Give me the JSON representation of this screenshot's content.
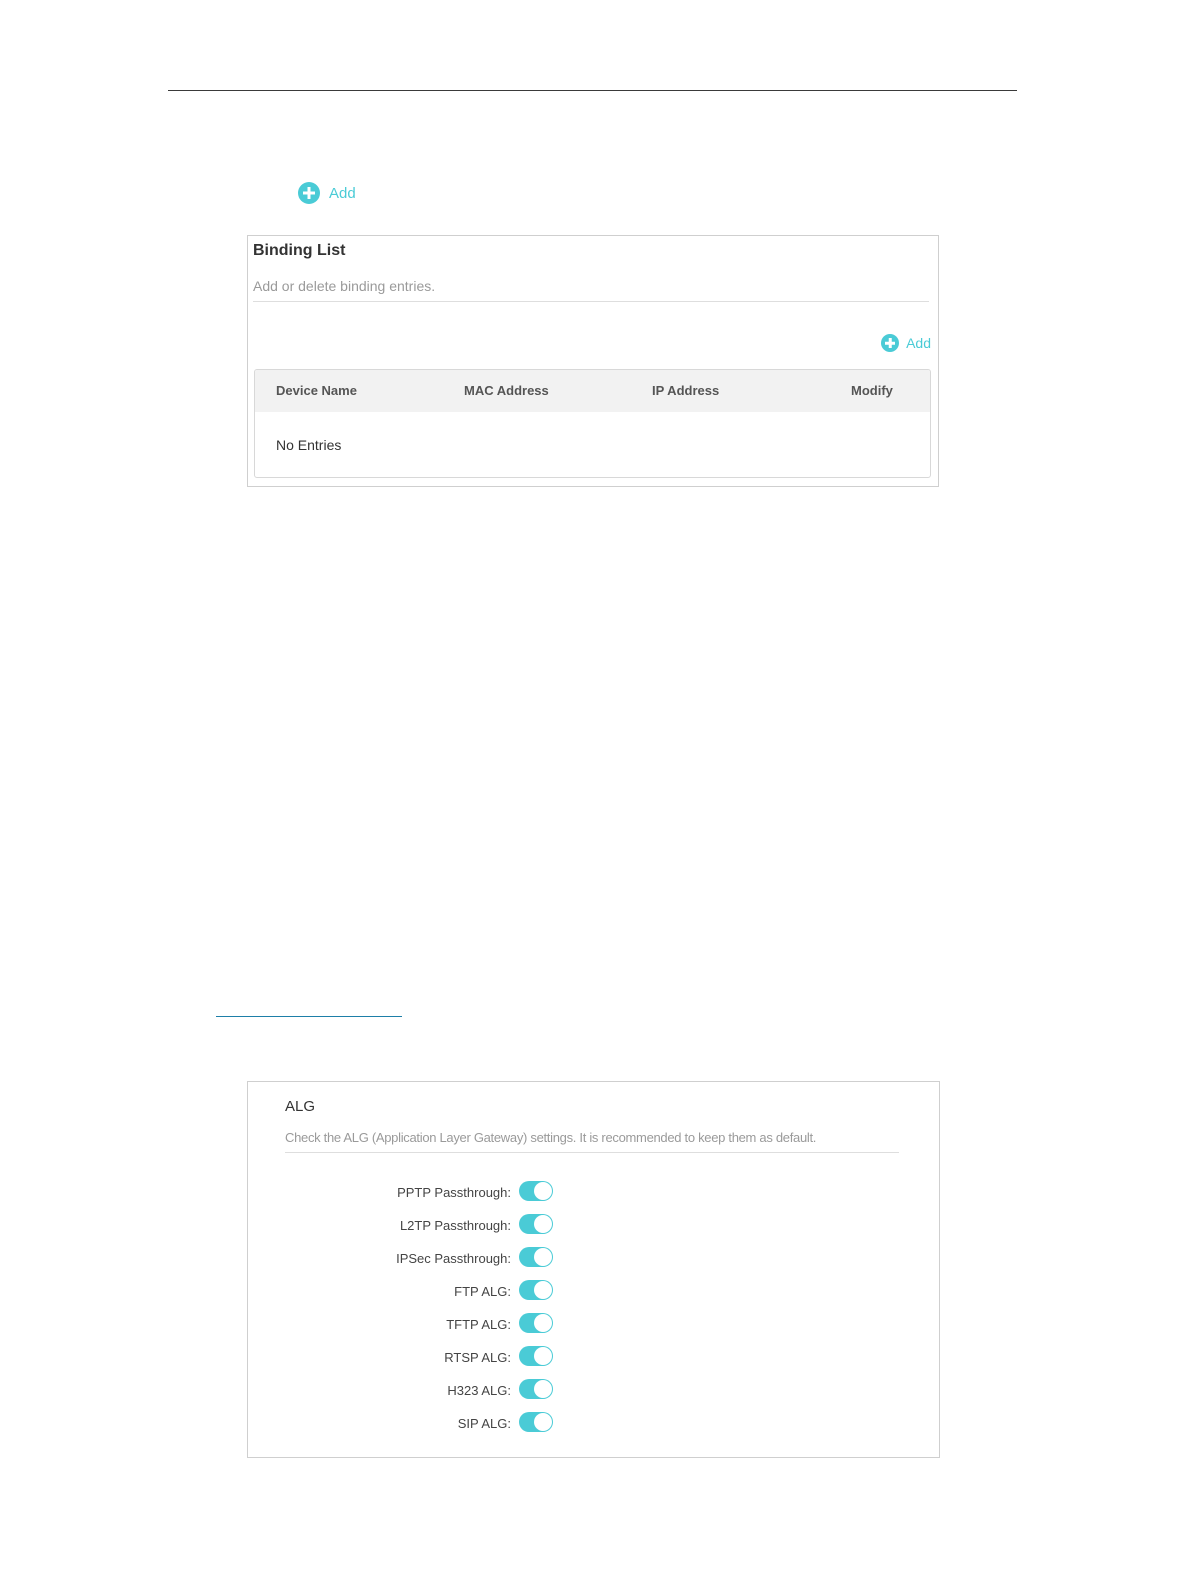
{
  "top_add": {
    "label": "Add"
  },
  "binding_list": {
    "title": "Binding List",
    "description": "Add or delete binding entries.",
    "add_label": "Add",
    "columns": [
      "Device Name",
      "MAC Address",
      "IP Address",
      "Modify"
    ],
    "empty_text": "No Entries"
  },
  "alg": {
    "title": "ALG",
    "description": "Check the ALG (Application Layer Gateway) settings. It is recommended to keep them as default.",
    "settings": [
      {
        "label": "PPTP Passthrough:",
        "enabled": true
      },
      {
        "label": "L2TP Passthrough:",
        "enabled": true
      },
      {
        "label": "IPSec Passthrough:",
        "enabled": true
      },
      {
        "label": "FTP ALG:",
        "enabled": true
      },
      {
        "label": "TFTP ALG:",
        "enabled": true
      },
      {
        "label": "RTSP ALG:",
        "enabled": true
      },
      {
        "label": "H323 ALG:",
        "enabled": true
      },
      {
        "label": "SIP ALG:",
        "enabled": true
      }
    ]
  },
  "colors": {
    "accent": "#4acbd6",
    "border": "#cfcfcf",
    "muted_text": "#9a9a9a"
  }
}
